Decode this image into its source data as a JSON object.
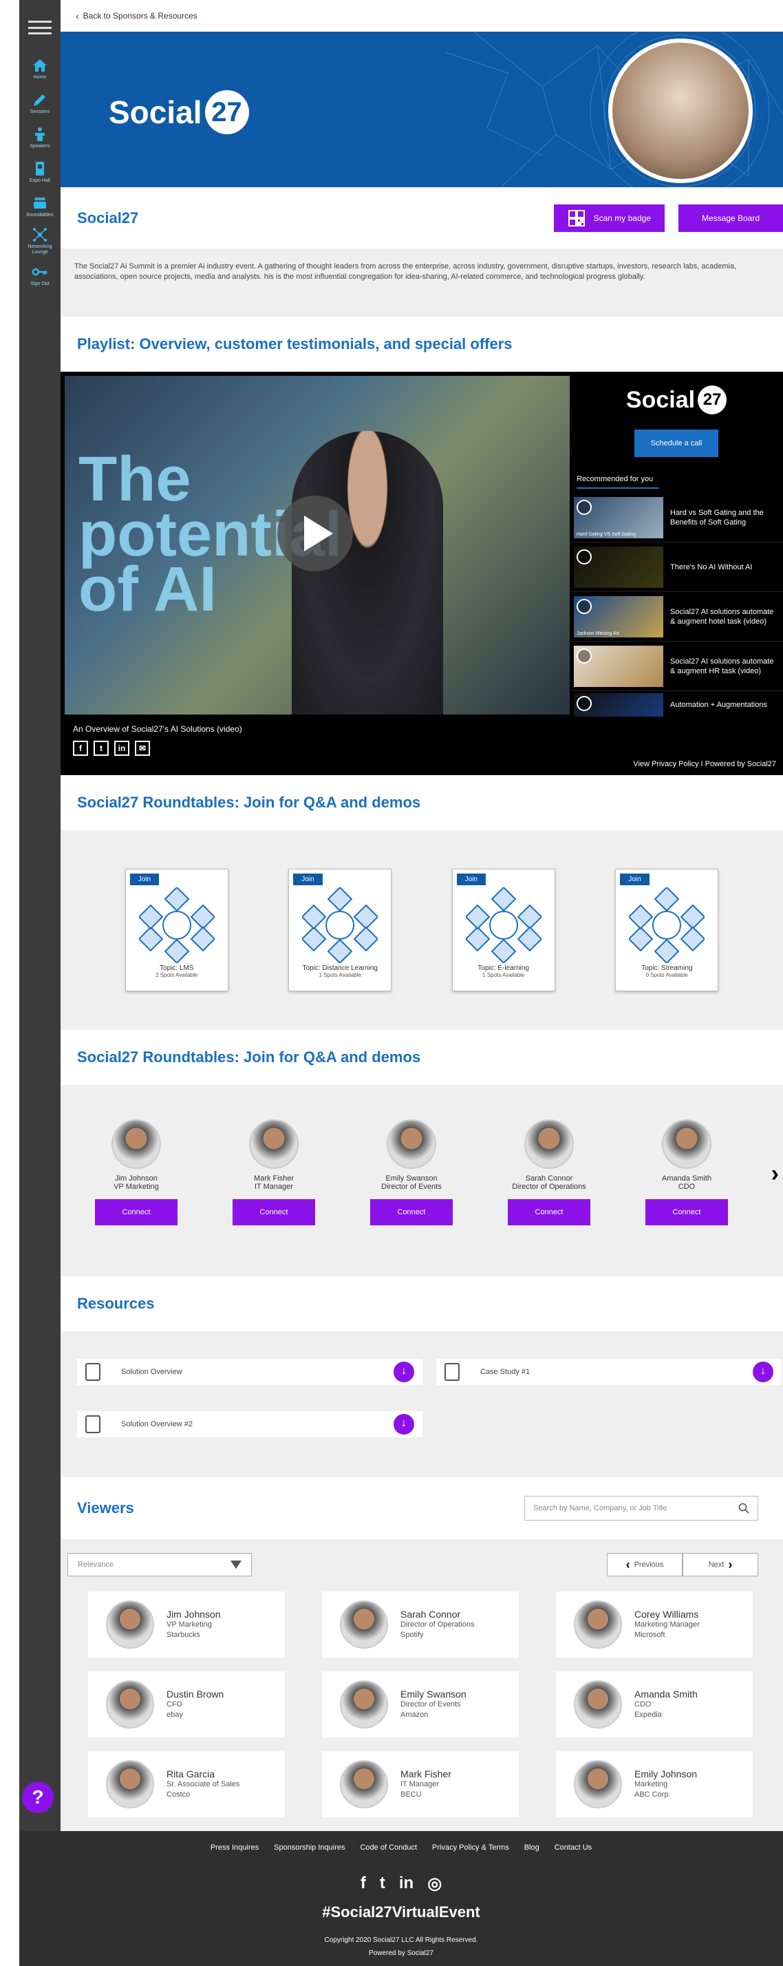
{
  "nav": {
    "items": [
      {
        "label": "Home",
        "icon": "home-icon"
      },
      {
        "label": "Sessions",
        "icon": "pencil-icon"
      },
      {
        "label": "Speakers",
        "icon": "podium-icon"
      },
      {
        "label": "Expo Hall",
        "icon": "booth-icon"
      },
      {
        "label": "Roundtables",
        "icon": "table-icon"
      },
      {
        "label": "Networking Lounge",
        "icon": "network-icon"
      },
      {
        "label": "Sign Out",
        "icon": "key-icon"
      }
    ]
  },
  "back_link": "Back to Sponsors & Resources",
  "brand": {
    "name": "Social",
    "badge": "27"
  },
  "sponsor": {
    "name": "Social27",
    "scan_label": "Scan my badge",
    "message_label": "Message Board",
    "description": "The Social27 Ai Summit is a premier Ai industry event. A gathering of thought leaders from across the enterprise, across industry, government, disruptive startups, investors, research labs, academia, associations, open source projects, media and analysts.  his is the most influential congregation for idea-sharing, AI-related commerce, and technological progress globally."
  },
  "playlist": {
    "title": "Playlist: Overview, customer testimonials, and special offers",
    "video_caption": "An Overview of Social27's AI Solutions (video)",
    "overlay_text": [
      "The",
      "potential",
      "of AI"
    ],
    "schedule_label": "Schedule a call",
    "recommended_label": "Recommended for you",
    "recommended": [
      {
        "title": "Hard vs Soft Gating and the Benefits of Soft Gating",
        "thumb_text": "Hard Gating VS Soft Gating"
      },
      {
        "title": "There's No AI Without AI",
        "thumb_text": ""
      },
      {
        "title": "Social27 AI solutions automate & augment hotel task (video)",
        "thumb_text": "Jackson Missing Art"
      },
      {
        "title": "Social27 AI solutions automate & augment HR task (video)",
        "thumb_text": ""
      },
      {
        "title": "Automation + Augmentations",
        "thumb_text": ""
      }
    ],
    "footer": "View Privacy Policy I Powered by Social27"
  },
  "roundtables": {
    "title": "Social27 Roundtables: Join for Q&A and demos",
    "join_label": "Join",
    "tables": [
      {
        "topic": "Topic: LMS",
        "spots": "2 Spots Available"
      },
      {
        "topic": "Topic: Distance Learning",
        "spots": "1 Spots Available"
      },
      {
        "topic": "Topic: E-learning",
        "spots": "1 Spots Available"
      },
      {
        "topic": "Topic: Streaming",
        "spots": "0 Spots Available"
      }
    ]
  },
  "people": {
    "title": "Social27 Roundtables: Join for Q&A and demos",
    "connect_label": "Connect",
    "items": [
      {
        "name": "Jim Johnson",
        "role": "VP Marketing"
      },
      {
        "name": "Mark Fisher",
        "role": "IT Manager"
      },
      {
        "name": "Emily Swanson",
        "role": "Director of Events"
      },
      {
        "name": "Sarah Connor",
        "role": "Director of Operations"
      },
      {
        "name": "Amanda Smith",
        "role": "CDO"
      }
    ]
  },
  "resources": {
    "title": "Resources",
    "items": [
      "Solution Overview",
      "Case Study #1",
      "Solution Overview #2"
    ]
  },
  "viewers": {
    "title": "Viewers",
    "search_placeholder": "Search by Name, Company, or Job Title",
    "sort_value": "Relevance",
    "prev_label": "Previous",
    "next_label": "Next",
    "items": [
      {
        "name": "Jim Johnson",
        "role": "VP Marketing",
        "company": "Starbucks"
      },
      {
        "name": "Sarah Connor",
        "role": "Director of Operations",
        "company": "Spotify"
      },
      {
        "name": "Corey Williams",
        "role": "Marketing Manager",
        "company": "Microsoft"
      },
      {
        "name": "Dustin Brown",
        "role": "CFO",
        "company": "ebay"
      },
      {
        "name": "Emily Swanson",
        "role": "Director of Events",
        "company": "Amazon"
      },
      {
        "name": "Amanda Smith",
        "role": "CDO",
        "company": "Expedia"
      },
      {
        "name": "Rita Garcia",
        "role": "Sr. Associate of Sales",
        "company": "Costco"
      },
      {
        "name": "Mark Fisher",
        "role": "IT Manager",
        "company": "BECU"
      },
      {
        "name": "Emily Johnson",
        "role": "Marketing",
        "company": "ABC Corp."
      }
    ]
  },
  "footer": {
    "links": [
      "Press Inquires",
      "Sponsorship Inquires",
      "Code of Conduct",
      "Privacy Policy & Terms",
      "Blog",
      "Contact Us"
    ],
    "hashtag": "#Social27VirtualEvent",
    "copyright": "Copyright 2020 Social27 LLC All Rights Reserved.",
    "powered_by": "Powered by Social27"
  },
  "help_label": "?",
  "colors": {
    "accent": "#8a12e8",
    "brand_blue": "#1b6fc2",
    "hero_blue": "#0f5aa6",
    "sidebar": "#3b3b3b",
    "nav_icon": "#2db8e8"
  }
}
